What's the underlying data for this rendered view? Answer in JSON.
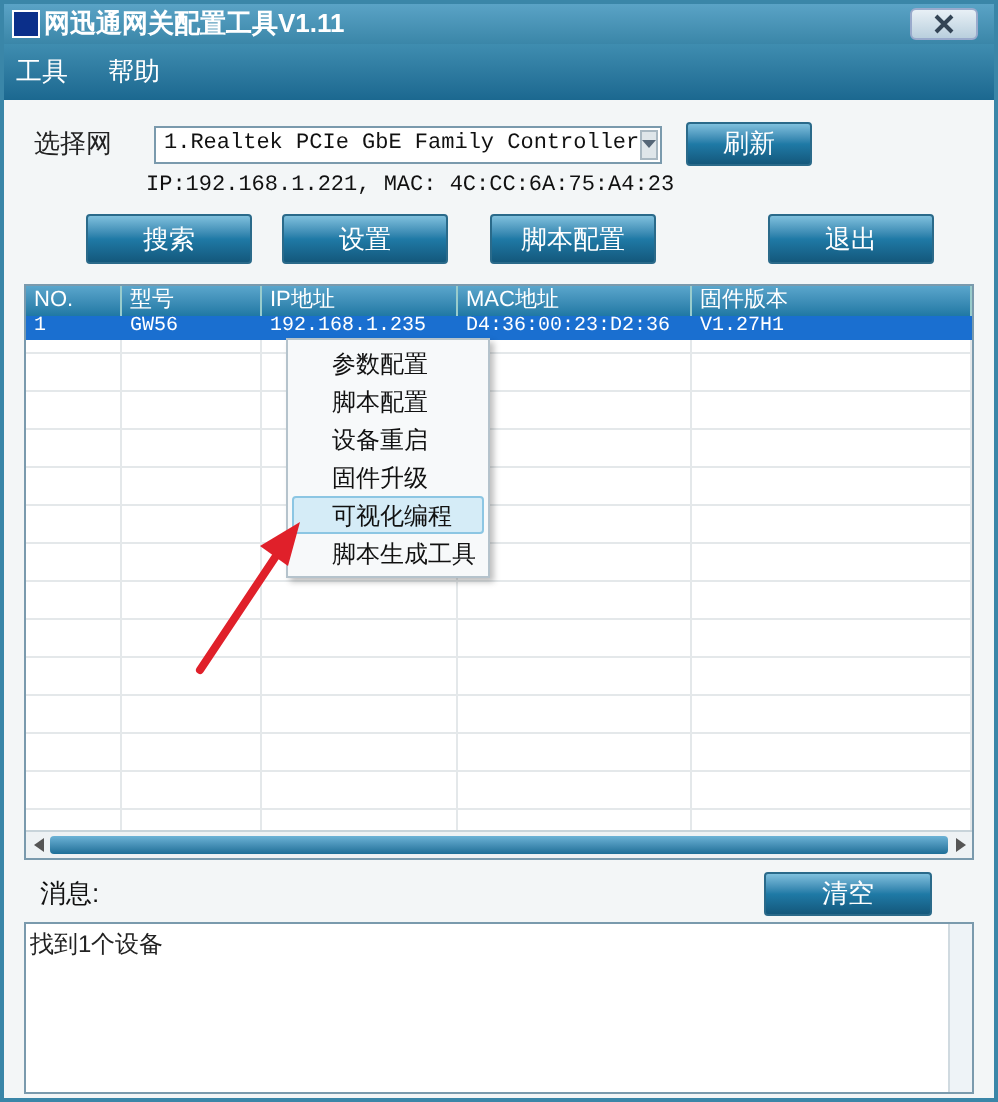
{
  "window": {
    "title": "网迅通网关配置工具V1.11"
  },
  "menu": [
    "工具",
    "帮助"
  ],
  "network": {
    "label": "选择网",
    "value": "1.Realtek PCIe GbE Family Controller",
    "refresh": "刷新",
    "info": "IP:192.168.1.221, MAC: 4C:CC:6A:75:A4:23"
  },
  "buttons": [
    {
      "label": "搜索",
      "kind": "left"
    },
    {
      "label": "设置",
      "kind": "left"
    },
    {
      "label": "脚本配置",
      "kind": "left"
    },
    {
      "label": "退出",
      "kind": "right"
    }
  ],
  "table": {
    "columns": [
      "NO.",
      "型号",
      "IP地址",
      "MAC地址",
      "固件版本"
    ],
    "rows": [
      {
        "selected": true,
        "cells": [
          "1",
          "GW56",
          "192.168.1.235",
          "D4:36:00:23:D2:36",
          "V1.27H1"
        ]
      }
    ]
  },
  "context_menu": [
    {
      "label": "参数配置",
      "selected": false
    },
    {
      "label": "脚本配置",
      "selected": false
    },
    {
      "label": "设备重启",
      "selected": false
    },
    {
      "label": "固件升级",
      "selected": false
    },
    {
      "label": "可视化编程",
      "selected": true
    },
    {
      "label": "脚本生成工具",
      "selected": false
    }
  ],
  "messages": {
    "label": "消息:",
    "clear": "清空",
    "text": "找到1个设备"
  }
}
